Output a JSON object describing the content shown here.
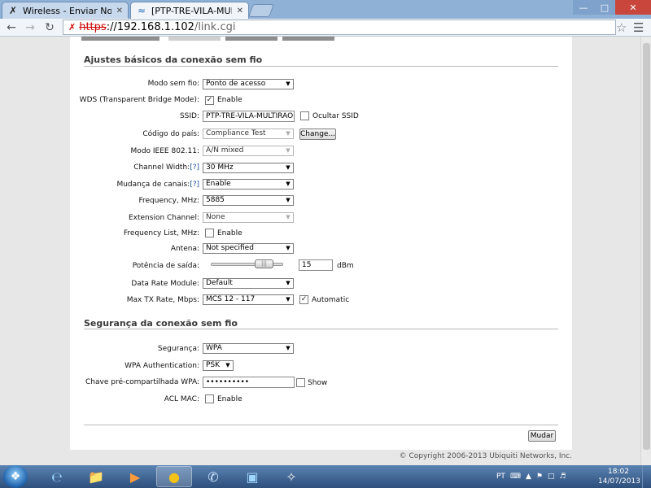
{
  "browser": {
    "tabs": [
      {
        "title": "Wireless - Enviar Novo Tópi",
        "active": false,
        "icon": "ubiquiti-icon"
      },
      {
        "title": "[PTP-TRE-VILA-MULTIRAO",
        "active": true,
        "icon": "wireless-icon"
      }
    ],
    "url": {
      "proto": "https",
      "host": "://192.168.1.102",
      "path": "/link.cgi"
    }
  },
  "basic_section": {
    "title": "Ajustes básicos da conexão sem fio",
    "wireless_mode": {
      "label": "Modo sem fio:",
      "value": "Ponto de acesso"
    },
    "wds": {
      "label": "WDS (Transparent Bridge Mode):",
      "checked": true,
      "option": "Enable"
    },
    "ssid": {
      "label": "SSID:",
      "value": "PTP-TRE-VILA-MULTIRAO",
      "hide_label": "Ocultar SSID",
      "hide_checked": false
    },
    "country": {
      "label": "Código do país:",
      "value": "Compliance Test",
      "change_label": "Change..."
    },
    "ieee_mode": {
      "label": "Modo IEEE 802.11:",
      "value": "A/N mixed"
    },
    "channel_width": {
      "label": "Channel Width:",
      "help": "[?]",
      "value": "30 MHz"
    },
    "channel_shift": {
      "label": "Mudança de canais:",
      "help": "[?]",
      "value": "Enable"
    },
    "frequency": {
      "label": "Frequency, MHz:",
      "value": "5885"
    },
    "extension_channel": {
      "label": "Extension Channel:",
      "value": "None"
    },
    "frequency_list": {
      "label": "Frequency List, MHz:",
      "checked": false,
      "option": "Enable"
    },
    "antenna": {
      "label": "Antena:",
      "value": "Not specified"
    },
    "output_power": {
      "label": "Potência de saída:",
      "value": "15",
      "unit": "dBm"
    },
    "data_rate_module": {
      "label": "Data Rate Module:",
      "value": "Default"
    },
    "max_tx_rate": {
      "label": "Max TX Rate, Mbps:",
      "value": "MCS 12 - 117",
      "auto_label": "Automatic",
      "auto_checked": true
    }
  },
  "security_section": {
    "title": "Segurança da conexão sem fio",
    "security": {
      "label": "Segurança:",
      "value": "WPA"
    },
    "wpa_auth": {
      "label": "WPA Authentication:",
      "value": "PSK"
    },
    "psk": {
      "label": "Chave pré-compartilhada WPA:",
      "value": "••••••••••",
      "show_label": "Show",
      "show_checked": false
    },
    "mac_acl": {
      "label": "ACL MAC:",
      "checked": false,
      "option": "Enable"
    }
  },
  "change_button": "Mudar",
  "footer": "© Copyright 2006-2013 Ubiquiti Networks, Inc.",
  "taskbar": {
    "language": "PT",
    "time": "18:02",
    "date": "14/07/2013"
  }
}
